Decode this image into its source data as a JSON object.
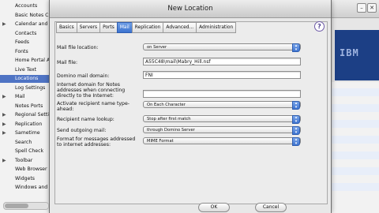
{
  "preferences_list": [
    {
      "label": "Accounts",
      "expandable": false,
      "selected": false
    },
    {
      "label": "Basic Notes Client Config",
      "expandable": false,
      "selected": false
    },
    {
      "label": "Calendar and To Do",
      "expandable": true,
      "selected": false
    },
    {
      "label": "Contacts",
      "expandable": false,
      "selected": false
    },
    {
      "label": "Feeds",
      "expandable": false,
      "selected": false
    },
    {
      "label": "Fonts",
      "expandable": false,
      "selected": false
    },
    {
      "label": "Home Portal Account",
      "expandable": false,
      "selected": false
    },
    {
      "label": "Live Text",
      "expandable": false,
      "selected": false
    },
    {
      "label": "Locations",
      "expandable": false,
      "selected": true
    },
    {
      "label": "Log Settings",
      "expandable": false,
      "selected": false
    },
    {
      "label": "Mail",
      "expandable": true,
      "selected": false
    },
    {
      "label": "Notes Ports",
      "expandable": false,
      "selected": false
    },
    {
      "label": "Regional Settings",
      "expandable": true,
      "selected": false
    },
    {
      "label": "Replication",
      "expandable": true,
      "selected": false
    },
    {
      "label": "Sametime",
      "expandable": true,
      "selected": false
    },
    {
      "label": "Search",
      "expandable": false,
      "selected": false
    },
    {
      "label": "Spell Check",
      "expandable": false,
      "selected": false
    },
    {
      "label": "Toolbar",
      "expandable": true,
      "selected": false
    },
    {
      "label": "Web Browser",
      "expandable": false,
      "selected": false
    },
    {
      "label": "Widgets",
      "expandable": false,
      "selected": false
    },
    {
      "label": "Windows and Themes",
      "expandable": false,
      "selected": false
    }
  ],
  "background_window": {
    "logo_text": "IBM"
  },
  "dialog": {
    "title": "New Location",
    "tabs": [
      {
        "label": "Basics",
        "active": false
      },
      {
        "label": "Servers",
        "active": false
      },
      {
        "label": "Ports",
        "active": false
      },
      {
        "label": "Mail",
        "active": true
      },
      {
        "label": "Replication",
        "active": false
      },
      {
        "label": "Advanced...",
        "active": false
      },
      {
        "label": "Administration",
        "active": false
      }
    ],
    "help_glyph": "?",
    "fields": {
      "mail_file_location": {
        "label": "Mail file location:",
        "value": "on Server"
      },
      "mail_file": {
        "label": "Mail file:",
        "value": "A55C48\\mail\\Mabry_Hill.nsf"
      },
      "domino_mail_domain": {
        "label": "Domino mail domain:",
        "value": "FNI"
      },
      "internet_domain": {
        "label": "Internet domain for Notes addresses when connecting directly to the Internet:",
        "value": ""
      },
      "activate_recipient_typeahead": {
        "label": "Activate recipient name type-ahead:",
        "value": "On Each Character"
      },
      "recipient_name_lookup": {
        "label": "Recipient name lookup:",
        "value": "Stop after first match"
      },
      "send_outgoing_mail": {
        "label": "Send outgoing mail:",
        "value": "through Domino Server"
      },
      "message_format": {
        "label": "Format for messages addressed to internet addresses:",
        "value": "MIME Format"
      }
    },
    "buttons": {
      "ok": "OK",
      "cancel": "Cancel"
    }
  },
  "colors": {
    "selection_blue": "#4f74c4",
    "tab_active": "#3c73cf",
    "dialog_bg": "#e8e8e8"
  }
}
